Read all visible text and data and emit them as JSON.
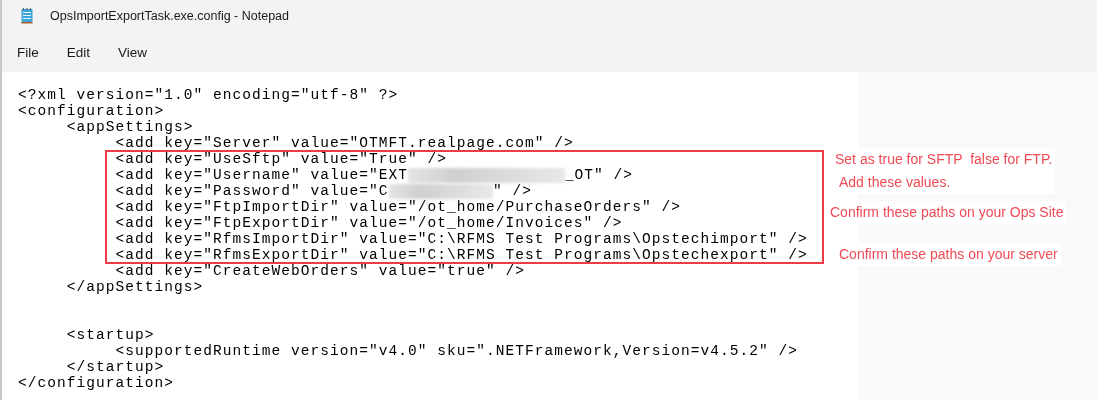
{
  "window": {
    "title": "OpsImportExportTask.exe.config - Notepad"
  },
  "menu": [
    "File",
    "Edit",
    "View"
  ],
  "editor": {
    "lines": [
      [
        {
          "kind": "text",
          "text": "<?xml version=\"1.0\" encoding=\"utf-8\" ?>"
        }
      ],
      [
        {
          "kind": "text",
          "text": "<configuration>"
        }
      ],
      [
        {
          "kind": "text",
          "text": "     <appSettings>"
        }
      ],
      [
        {
          "kind": "text",
          "text": "          <add key=\"Server\" value=\"OTMFT.realpage.com\" />"
        }
      ],
      [
        {
          "kind": "text",
          "text": "          <add key=\"UseSftp\" value=\"True\" />"
        }
      ],
      [
        {
          "kind": "text",
          "text": "          <add key=\"Username\" value=\"EXT"
        },
        {
          "kind": "redacted"
        },
        {
          "kind": "text",
          "text": "_OT\" />"
        }
      ],
      [
        {
          "kind": "text",
          "text": "          <add key=\"Password\" value=\"C"
        },
        {
          "kind": "redacted"
        },
        {
          "kind": "text",
          "text": "\" />"
        }
      ],
      [
        {
          "kind": "text",
          "text": "          <add key=\"FtpImportDir\" value=\"/ot_home/PurchaseOrders\" />"
        }
      ],
      [
        {
          "kind": "text",
          "text": "          <add key=\"FtpExportDir\" value=\"/ot_home/Invoices\" />"
        }
      ],
      [
        {
          "kind": "text",
          "text": "          <add key=\"RfmsImportDir\" value=\"C:\\RFMS Test Programs\\Opstechimport\" />"
        }
      ],
      [
        {
          "kind": "text",
          "text": "          <add key=\"RfmsExportDir\" value=\"C:\\RFMS Test Programs\\Opstechexport\" />"
        }
      ],
      [
        {
          "kind": "text",
          "text": "          <add key=\"CreateWebOrders\" value=\"true\" />"
        }
      ],
      [
        {
          "kind": "text",
          "text": "     </appSettings>"
        }
      ],
      [
        {
          "kind": "blank"
        }
      ],
      [
        {
          "kind": "blank"
        }
      ],
      [
        {
          "kind": "text",
          "text": "     <startup>"
        }
      ],
      [
        {
          "kind": "text",
          "text": "          <supportedRuntime version=\"v4.0\" sku=\".NETFramework,Version=v4.5.2\" />"
        }
      ],
      [
        {
          "kind": "text",
          "text": "     </startup>"
        }
      ],
      [
        {
          "kind": "text",
          "text": "</configuration>"
        }
      ]
    ]
  },
  "annotations": [
    {
      "lines": [
        "Set as true for SFTP  false for FTP.",
        "Add these values."
      ]
    },
    {
      "lines": [
        "Confirm these paths on your Ops Site"
      ]
    },
    {
      "lines": [
        "Confirm these paths on your server"
      ]
    }
  ]
}
